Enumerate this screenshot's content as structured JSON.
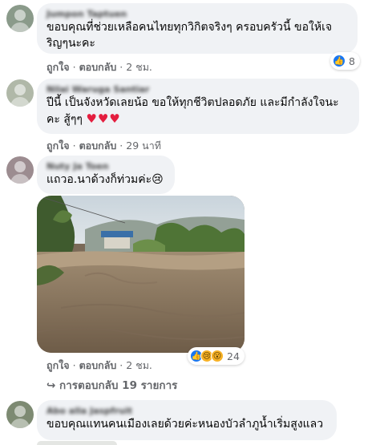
{
  "comments": [
    {
      "name": "Jumpon Taptuen",
      "text_line1": "ขอบคุณที่ช่วยเหลือคนไทยทุกวิกิตจริงๆ ครอบครัวนี้ ขอให้เจ",
      "text_line2": "ริญๆนะคะ",
      "like_label": "ถูกใจ",
      "reply_label": "ตอบกลับ",
      "time": "2 ชม.",
      "reaction_count": "8",
      "avatar_color": "#8a9a8a"
    },
    {
      "name": "Nilai Waruga Santiar",
      "text_line1": "ปีนี้ เป็นจังหวัดเลยน้อ ขอให้ทุกชีวิตปลอดภัย และมีกำลังใจนะ",
      "text_line2": "คะ สู้ๆๆ",
      "hearts": "♥♥♥",
      "like_label": "ถูกใจ",
      "reply_label": "ตอบกลับ",
      "time": "29 นาที",
      "avatar_color": "#b0b8a8"
    },
    {
      "name": "Nuty Ja Toen",
      "text": "แถวอ.นาด้วงก็ท่วมค่ะ😢",
      "like_label": "ถูกใจ",
      "reply_label": "ตอบกลับ",
      "time": "2 ชม.",
      "reaction_count": "24",
      "avatar_color": "#9c8c90"
    },
    {
      "name": "Abo alla Jaspfruit",
      "text": "ขอบคุณแทนคนเมืองเลยด้วยค่ะหนองบัวลำภูน้ำเริ่มสูงแลว",
      "avatar_color": "#7d8a72"
    }
  ],
  "replies_link": "การตอบกลับ 19 รายการ",
  "icons": {
    "like": "thumbs-up-icon",
    "sad": "sad-face-icon",
    "wow": "wow-face-icon",
    "reply_arrow": "reply-arrow-icon"
  },
  "colors": {
    "bubble": "#f0f2f5",
    "like_blue": "#1877f2",
    "muted": "#65676b",
    "heart": "#e41e3f"
  }
}
